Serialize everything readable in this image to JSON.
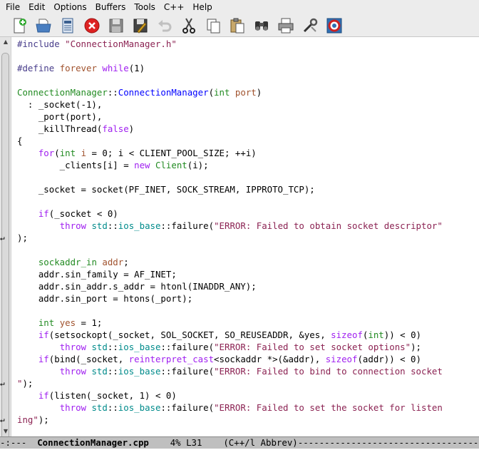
{
  "menubar": {
    "items": [
      {
        "label": "File"
      },
      {
        "label": "Edit"
      },
      {
        "label": "Options"
      },
      {
        "label": "Buffers"
      },
      {
        "label": "Tools"
      },
      {
        "label": "C++"
      },
      {
        "label": "Help"
      }
    ]
  },
  "toolbar": {
    "buttons": [
      {
        "icon": "new-file-icon"
      },
      {
        "icon": "open-folder-icon"
      },
      {
        "icon": "open-directory-icon"
      },
      {
        "icon": "close-buffer-icon"
      },
      {
        "icon": "save-icon"
      },
      {
        "icon": "save-as-icon"
      },
      {
        "icon": "undo-icon"
      },
      {
        "icon": "cut-icon"
      },
      {
        "icon": "copy-icon"
      },
      {
        "icon": "paste-icon"
      },
      {
        "icon": "search-binoculars-icon"
      },
      {
        "icon": "print-icon"
      },
      {
        "icon": "preferences-icon"
      },
      {
        "icon": "help-lifebuoy-icon"
      }
    ]
  },
  "editor": {
    "wrap_glyph": "↵",
    "lines": [
      "#include \"ConnectionManager.h\"",
      "",
      "#define forever while(1)",
      "",
      "ConnectionManager::ConnectionManager(int port)",
      "  : _socket(-1),",
      "    _port(port),",
      "    _killThread(false)",
      "{",
      "    for(int i = 0; i < CLIENT_POOL_SIZE; ++i)",
      "        _clients[i] = new Client(i);",
      "",
      "    _socket = socket(PF_INET, SOCK_STREAM, IPPROTO_TCP);",
      "",
      "    if(_socket < 0)",
      "        throw std::ios_base::failure(\"ERROR: Failed to obtain socket descriptor\"",
      ");",
      "",
      "    sockaddr_in addr;",
      "    addr.sin_family = AF_INET;",
      "    addr.sin_addr.s_addr = htonl(INADDR_ANY);",
      "    addr.sin_port = htons(_port);",
      "",
      "    int yes = 1;",
      "    if(setsockopt(_socket, SOL_SOCKET, SO_REUSEADDR, &yes, sizeof(int)) < 0)",
      "        throw std::ios_base::failure(\"ERROR: Failed to set socket options\");",
      "    if(bind(_socket, reinterpret_cast<sockaddr *>(&addr), sizeof(addr)) < 0)",
      "        throw std::ios_base::failure(\"ERROR: Failed to bind to connection socket",
      "\");",
      "    if(listen(_socket, 1) < 0)",
      "        throw std::ios_base::failure(\"ERROR: Failed to set the socket for listen",
      "ing\");"
    ]
  },
  "modeline": {
    "prefix": "-:---  ",
    "buffer_name": "ConnectionManager.cpp",
    "position": "    4% L31    ",
    "mode": "(C++/l Abbrev)",
    "fill": "---------------------------------------------"
  },
  "colors": {
    "keyword": "#a020f0",
    "type": "#228b22",
    "function": "#0000ff",
    "variable": "#a0522d",
    "string": "#8b2252",
    "preprocessor": "#483d8b",
    "constant": "#008b8b"
  }
}
